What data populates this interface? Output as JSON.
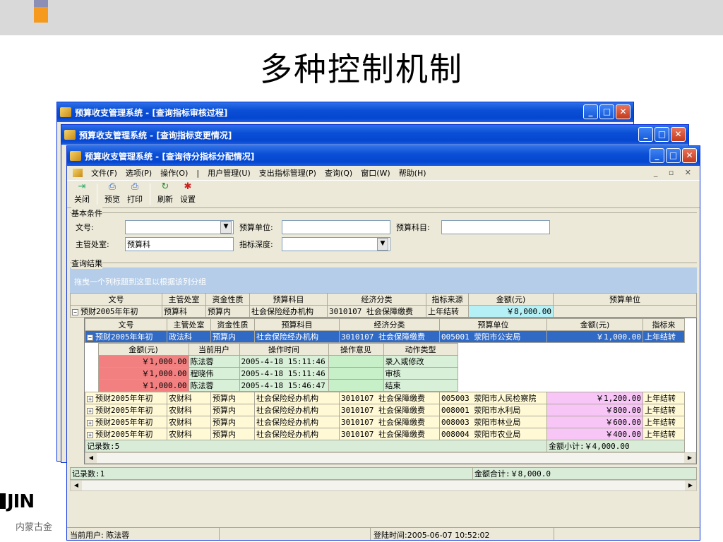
{
  "slide": {
    "title": "多种控制机制",
    "logo": "JIN",
    "company": "内蒙古金"
  },
  "win_back1": {
    "title": "预算收支管理系统 - [查询指标审核过程]"
  },
  "win_back2": {
    "title": "预算收支管理系统 - [查询指标变更情况]"
  },
  "win": {
    "title": "预算收支管理系统 - [查询待分指标分配情况]",
    "menu": [
      "文件(F)",
      "选项(P)",
      "操作(O)",
      "|",
      "用户管理(U)",
      "支出指标管理(P)",
      "查询(Q)",
      "窗口(W)",
      "帮助(H)"
    ],
    "toolbar": [
      "关闭",
      "预览",
      "打印",
      "刷新",
      "设置"
    ],
    "cond_label": "基本条件",
    "f_wenhao": "文号:",
    "f_ysdw": "预算单位:",
    "f_yskm": "预算科目:",
    "f_zgcs": "主管处室:",
    "f_zgcs_val": "预算科",
    "f_zbsd": "指标深度:",
    "result_label": "查询结果",
    "group_hint": "拖曳一个列标题到这里以根据该列分组",
    "outer_cols": [
      "文号",
      "主管处室",
      "资金性质",
      "预算科目",
      "经济分类",
      "指标来源",
      "金额(元)",
      "预算单位"
    ],
    "outer_row": [
      "预财2005年年初",
      "预算科",
      "预算内",
      "社会保险经办机构",
      "3010107 社会保障缴费",
      "上年结转",
      "￥8,000.00",
      ""
    ],
    "inner_cols": [
      "文号",
      "主管处室",
      "资金性质",
      "预算科目",
      "经济分类",
      "预算单位",
      "金额(元)",
      "指标来"
    ],
    "inner_rows": [
      [
        "预财2005年年初",
        "政法科",
        "预算内",
        "社会保险经办机构",
        "3010107 社会保障缴费",
        "005001 荥阳市公安局",
        "￥1,000.00",
        "上年结转"
      ],
      [
        "预财2005年年初",
        "农财科",
        "预算内",
        "社会保险经办机构",
        "3010107 社会保障缴费",
        "005003 荥阳市人民检察院",
        "￥1,200.00",
        "上年结转"
      ],
      [
        "预财2005年年初",
        "农财科",
        "预算内",
        "社会保险经办机构",
        "3010107 社会保障缴费",
        "008001 荥阳市水利局",
        "￥800.00",
        "上年结转"
      ],
      [
        "预财2005年年初",
        "农财科",
        "预算内",
        "社会保险经办机构",
        "3010107 社会保障缴费",
        "008003 荥阳市林业局",
        "￥600.00",
        "上年结转"
      ],
      [
        "预财2005年年初",
        "农财科",
        "预算内",
        "社会保险经办机构",
        "3010107 社会保障缴费",
        "008004 荥阳市农业局",
        "￥400.00",
        "上年结转"
      ]
    ],
    "detail_cols": [
      "金额(元)",
      "当前用户",
      "操作时间",
      "操作意见",
      "动作类型"
    ],
    "detail_rows": [
      [
        "￥1,000.00",
        "陈法蓉",
        "2005-4-18 15:11:46",
        "",
        "录入或修改"
      ],
      [
        "￥1,000.00",
        "程晓伟",
        "2005-4-18 15:11:46",
        "",
        "审核"
      ],
      [
        "￥1,000.00",
        "陈法蓉",
        "2005-4-18 15:46:47",
        "",
        "结束"
      ]
    ],
    "inner_count": "记录数:5",
    "inner_subtotal": "金额小计:￥4,000.00",
    "outer_count": "记录数:1",
    "outer_total": "金额合计:￥8,000.0",
    "status_user": "当前用户: 陈法蓉",
    "status_time": "登陆时间:2005-06-07 10:52:02"
  }
}
